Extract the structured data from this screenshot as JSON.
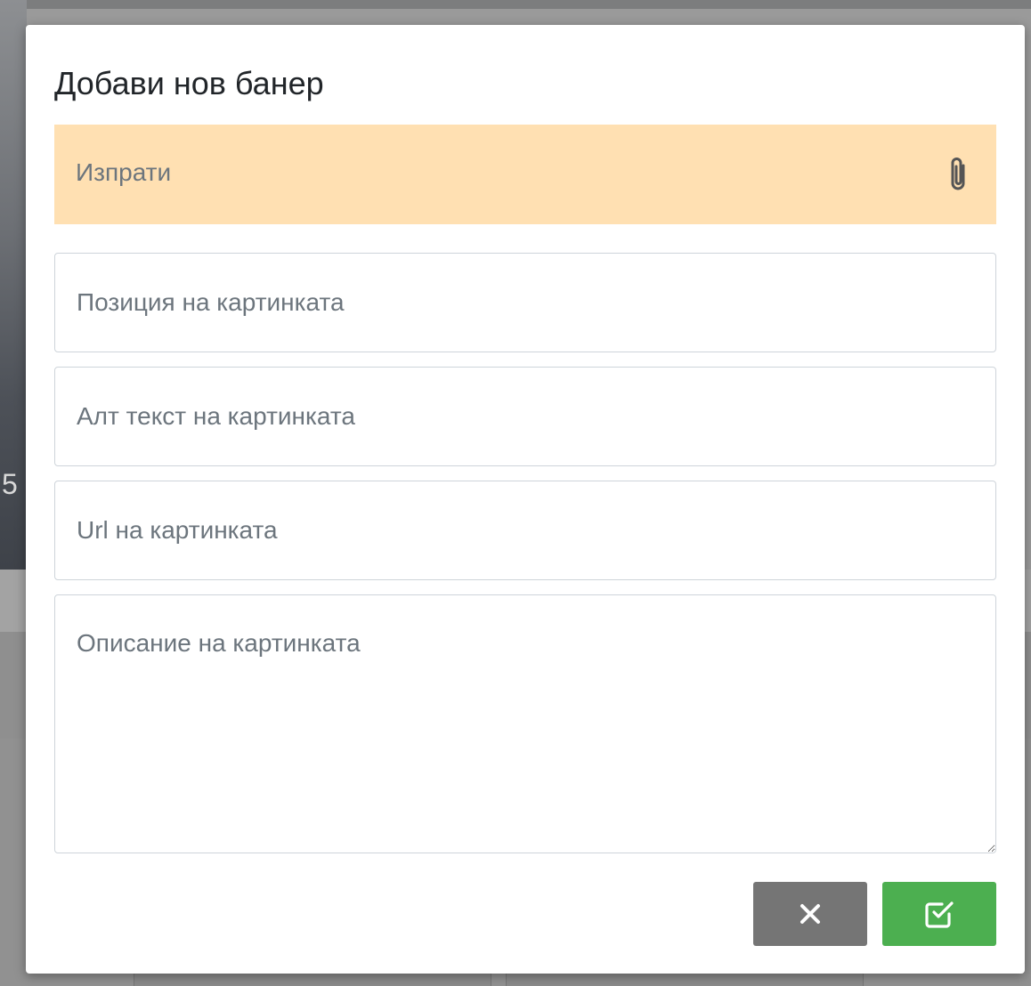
{
  "modal": {
    "title": "Добави нов банер",
    "upload": {
      "label": "Изпрати",
      "icon": "paperclip-icon"
    },
    "fields": {
      "position_placeholder": "Позиция на картинката",
      "alt_placeholder": "Алт текст на картинката",
      "url_placeholder": "Url на картинката",
      "description_placeholder": "Описание на картинката"
    },
    "buttons": {
      "cancel_icon": "close-icon",
      "confirm_icon": "check-square-icon"
    },
    "colors": {
      "upload_bg": "#ffe0b2",
      "cancel_bg": "#757575",
      "confirm_bg": "#4caf50"
    }
  },
  "background": {
    "partial_digit": "5"
  }
}
